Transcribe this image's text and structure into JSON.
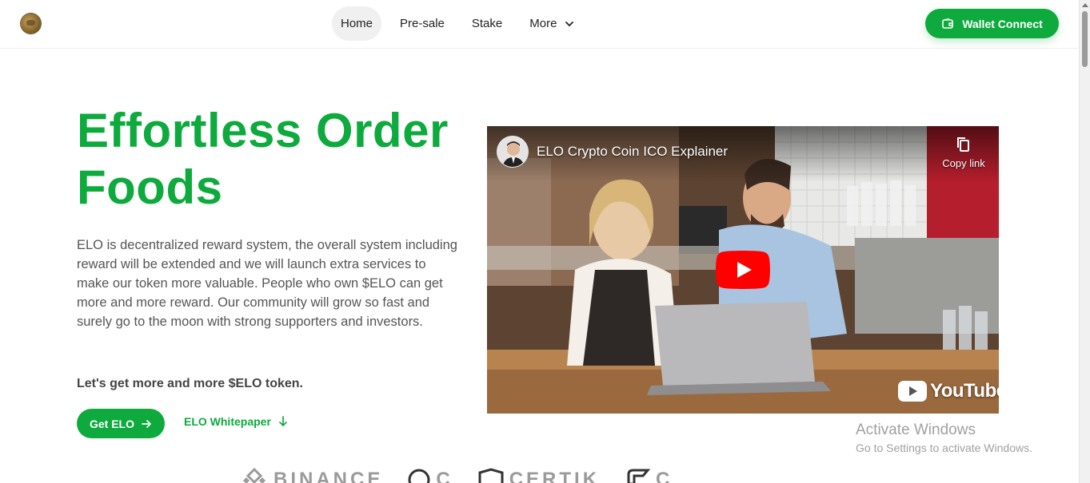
{
  "header": {
    "nav": [
      {
        "label": "Home",
        "active": true
      },
      {
        "label": "Pre-sale",
        "active": false
      },
      {
        "label": "Stake",
        "active": false
      },
      {
        "label": "More",
        "active": false,
        "dropdown": true
      }
    ],
    "wallet_button": "Wallet Connect"
  },
  "hero": {
    "title_line1": "Effortless Order",
    "title_line2": "Foods",
    "description": "ELO is decentralized reward system, the overall system including reward will be extended and we will launch extra services to make our token more valuable. People who own $ELO can get more and more reward. Our community will grow so fast and surely go to the moon with strong supporters and investors.",
    "cta_text": "Let's get more and more $ELO token.",
    "primary_button": "Get ELO",
    "secondary_link": "ELO Whitepaper"
  },
  "video": {
    "title": "ELO Crypto Coin ICO Explainer",
    "copy_link": "Copy link",
    "brand": "YouTube"
  },
  "partners": [
    "BINANCE",
    "C",
    "CERTIK",
    "C"
  ],
  "watermark": {
    "line1": "Activate Windows",
    "line2": "Go to Settings to activate Windows."
  },
  "colors": {
    "brand_green": "#0eaa3e",
    "youtube_red": "#ff0000"
  }
}
